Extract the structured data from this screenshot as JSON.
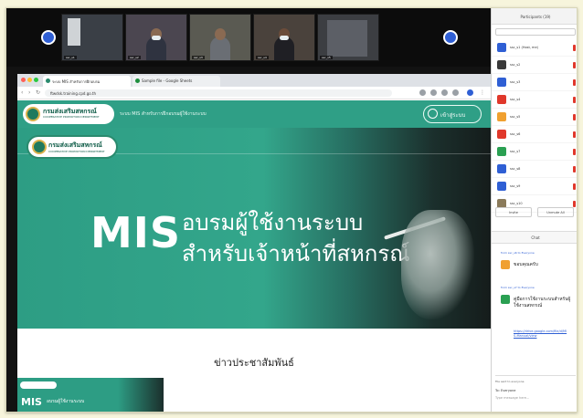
{
  "window": {
    "participants_title": "Participants (19)"
  },
  "gallery": {
    "tiles": [
      {
        "label": "ssc_s1"
      },
      {
        "label": "ssc_s2"
      },
      {
        "label": "ssc_s3"
      },
      {
        "label": "ssc_s4"
      },
      {
        "label": "ssc_s5"
      },
      {
        "label": "ssc_s6"
      }
    ]
  },
  "browser": {
    "tabs": [
      "ระบบ MIS สำหรับการฝึกอบรม",
      "Sample file - Google Sheets"
    ],
    "url": "ftwdsk.training.cpd.go.th"
  },
  "site": {
    "logo_text": "กรมส่งเสริมสหกรณ์",
    "logo_sub": "COOPERATIVE PROMOTION DEPARTMENT",
    "header_title": "ระบบ MIS สำหรับการฝึกอบรมผู้ใช้งานระบบ",
    "login_label": "เข้าสู่ระบบ",
    "hero_mis": "MIS",
    "hero_line1": "อบรมผู้ใช้งานระบบ",
    "hero_line2": "สำหรับเจ้าหน้าที่สหกรณ์",
    "news_title": "ข่าวประชาสัมพันธ์",
    "news_thumb_text": "MIS",
    "news_thumb_sub": "อบรมผู้ใช้งานระบบ"
  },
  "participants": [
    {
      "name": "ssc_s1 (Host, me)",
      "color": "#2f5fd4"
    },
    {
      "name": "ssc_s2",
      "color": "#3a3a3a"
    },
    {
      "name": "ssc_s3",
      "color": "#2f5fd4"
    },
    {
      "name": "ssc_s4",
      "color": "#e0382b"
    },
    {
      "name": "ssc_s5",
      "color": "#f0a030"
    },
    {
      "name": "ssc_s6",
      "color": "#e0382b"
    },
    {
      "name": "ssc_s7",
      "color": "#2aa052"
    },
    {
      "name": "ssc_s8",
      "color": "#2f5fd4"
    },
    {
      "name": "ssc_s9",
      "color": "#2f5fd4"
    },
    {
      "name": "ssc_s10",
      "color": "#8a7a5a"
    }
  ],
  "panel_buttons": [
    "Invite",
    "Unmute All"
  ],
  "chat": {
    "title": "Chat",
    "messages": [
      {
        "from": "from ssc_s6 to Everyone",
        "text": "ขอบคุณครับ",
        "color": "#f0a030"
      },
      {
        "from": "from ssc_s7 to Everyone",
        "text": "คู่มือการใช้งานระบบสำหรับผู้ใช้งานสหกรณ์",
        "link": "https://drive.google.com/file/d/MIS-Manual/view",
        "color": "#2aa052"
      }
    ],
    "file_note": "File sent to everyone",
    "to_label": "To: Everyone",
    "placeholder": "Type message here..."
  }
}
